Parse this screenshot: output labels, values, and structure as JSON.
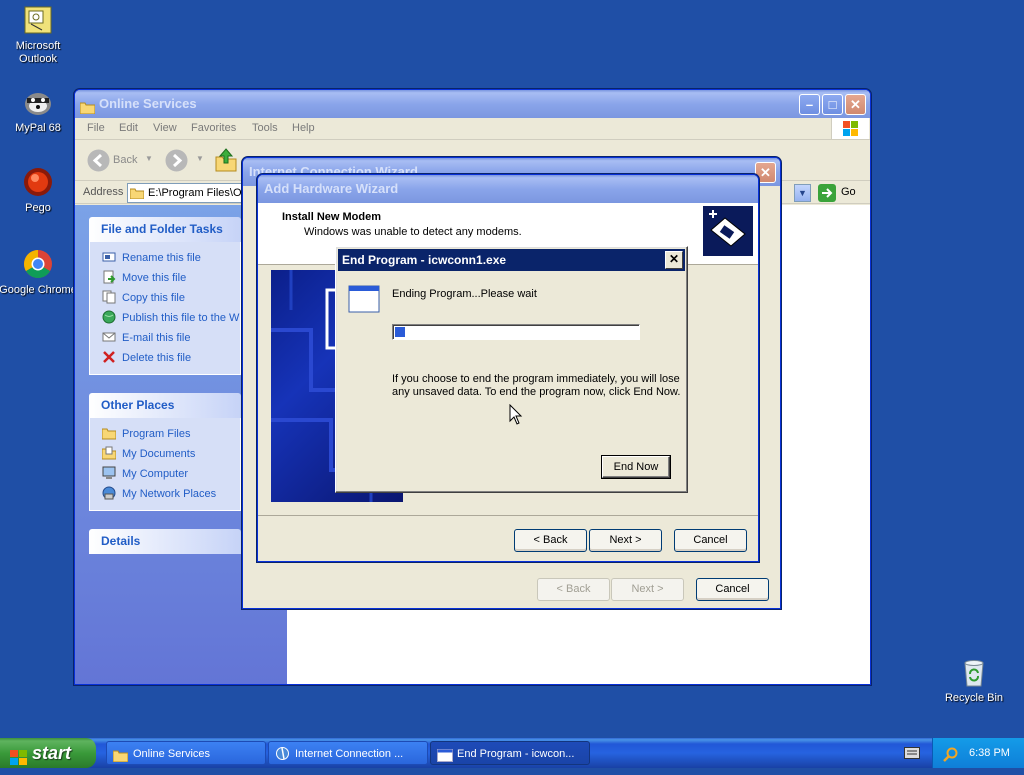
{
  "colors": {
    "desktop": "#1f4fa6",
    "title_active": "#0a5ee6",
    "classic_title": "#0a246a",
    "progress": "#2a5bd7",
    "link_blue": "#215dc6"
  },
  "desktop": {
    "icons": [
      {
        "label": "Microsoft Outlook",
        "icon": "outlook-icon"
      },
      {
        "label": "MyPal 68",
        "icon": "mypal-icon"
      },
      {
        "label": "Pego",
        "icon": "pego-icon"
      },
      {
        "label": "Google Chrome",
        "icon": "chrome-icon"
      },
      {
        "label": "Recycle Bin",
        "icon": "recycle-bin-icon"
      }
    ]
  },
  "explorer": {
    "title": "Online Services",
    "menu": [
      "File",
      "Edit",
      "View",
      "Favorites",
      "Tools",
      "Help"
    ],
    "toolbar": {
      "back": "Back"
    },
    "address_label": "Address",
    "address_value": "E:\\Program Files\\Or",
    "go_label": "Go",
    "file_tasks_title": "File and Folder Tasks",
    "file_tasks": [
      "Rename this file",
      "Move this file",
      "Copy this file",
      "Publish this file to the W",
      "E-mail this file",
      "Delete this file"
    ],
    "other_places_title": "Other Places",
    "other_places": [
      "Program Files",
      "My Documents",
      "My Computer",
      "My Network Places"
    ],
    "details_title": "Details"
  },
  "icw": {
    "title": "Internet Connection Wizard",
    "back": "< Back",
    "next": "Next >",
    "cancel": "Cancel"
  },
  "hardware": {
    "title": "Add Hardware Wizard",
    "heading": "Install New Modem",
    "subheading": "Windows was unable to detect any modems.",
    "back": "< Back",
    "next": "Next >",
    "cancel": "Cancel"
  },
  "endprog": {
    "title": "End Program - icwconn1.exe",
    "status": "Ending Program...Please wait",
    "progress": 0.04,
    "message": "If you choose to end the program immediately, you will lose any unsaved data. To end the program now, click End Now.",
    "end_now": "End Now"
  },
  "taskbar": {
    "start": "start",
    "tasks": [
      "Online Services",
      "Internet Connection ...",
      "End Program - icwcon..."
    ],
    "clock": "6:38 PM"
  }
}
